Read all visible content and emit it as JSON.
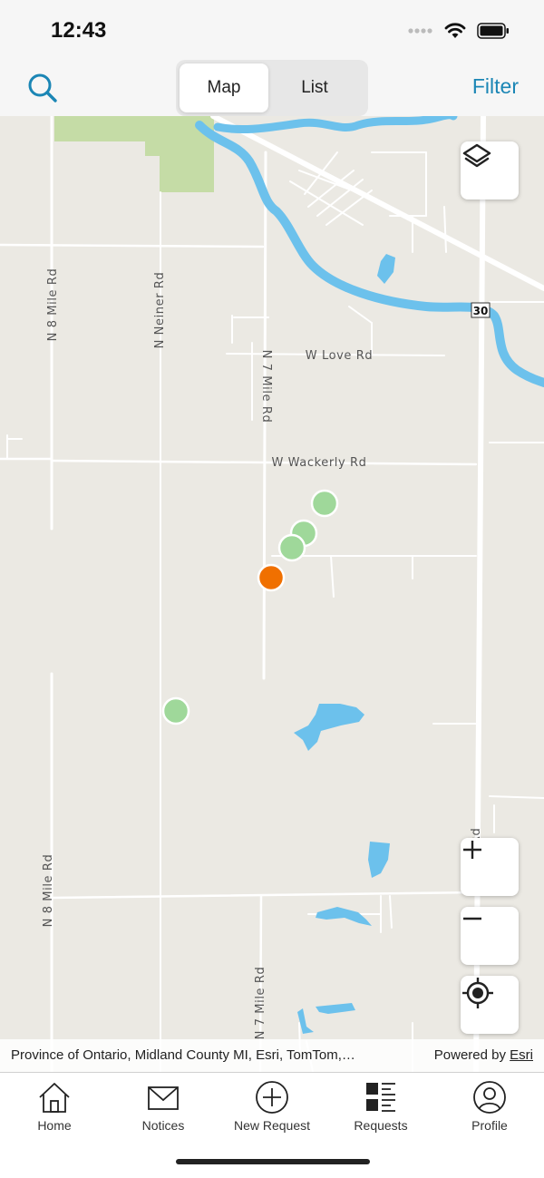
{
  "status": {
    "time": "12:43"
  },
  "topbar": {
    "segments": [
      {
        "label": "Map",
        "active": true
      },
      {
        "label": "List",
        "active": false
      }
    ],
    "filter_label": "Filter"
  },
  "map": {
    "road_labels": {
      "n8_upper": "N 8 Mile Rd",
      "neiner": "N Neiner Rd",
      "n7_upper": "N 7 Mile Rd",
      "love": "W Love Rd",
      "wackerly": "W Wackerly Rd",
      "n8_lower": "N 8 Mile Rd",
      "n7_lower": "N 7 Mile Rd",
      "right_road": "N …n Rd",
      "shield_30": "30"
    },
    "colors": {
      "green_marker": "#9fd89a",
      "orange_marker": "#f07000",
      "water": "#6cc1ec",
      "park": "#c5dca6"
    }
  },
  "attribution": {
    "sources": "Province of Ontario, Midland County MI, Esri, TomTom,…",
    "powered_by": "Powered by",
    "esri_link": "Esri"
  },
  "tabs": [
    {
      "label": "Home",
      "icon": "home-icon"
    },
    {
      "label": "Notices",
      "icon": "envelope-icon"
    },
    {
      "label": "New Request",
      "icon": "plus-circle-icon"
    },
    {
      "label": "Requests",
      "icon": "list-icon"
    },
    {
      "label": "Profile",
      "icon": "user-circle-icon"
    }
  ]
}
